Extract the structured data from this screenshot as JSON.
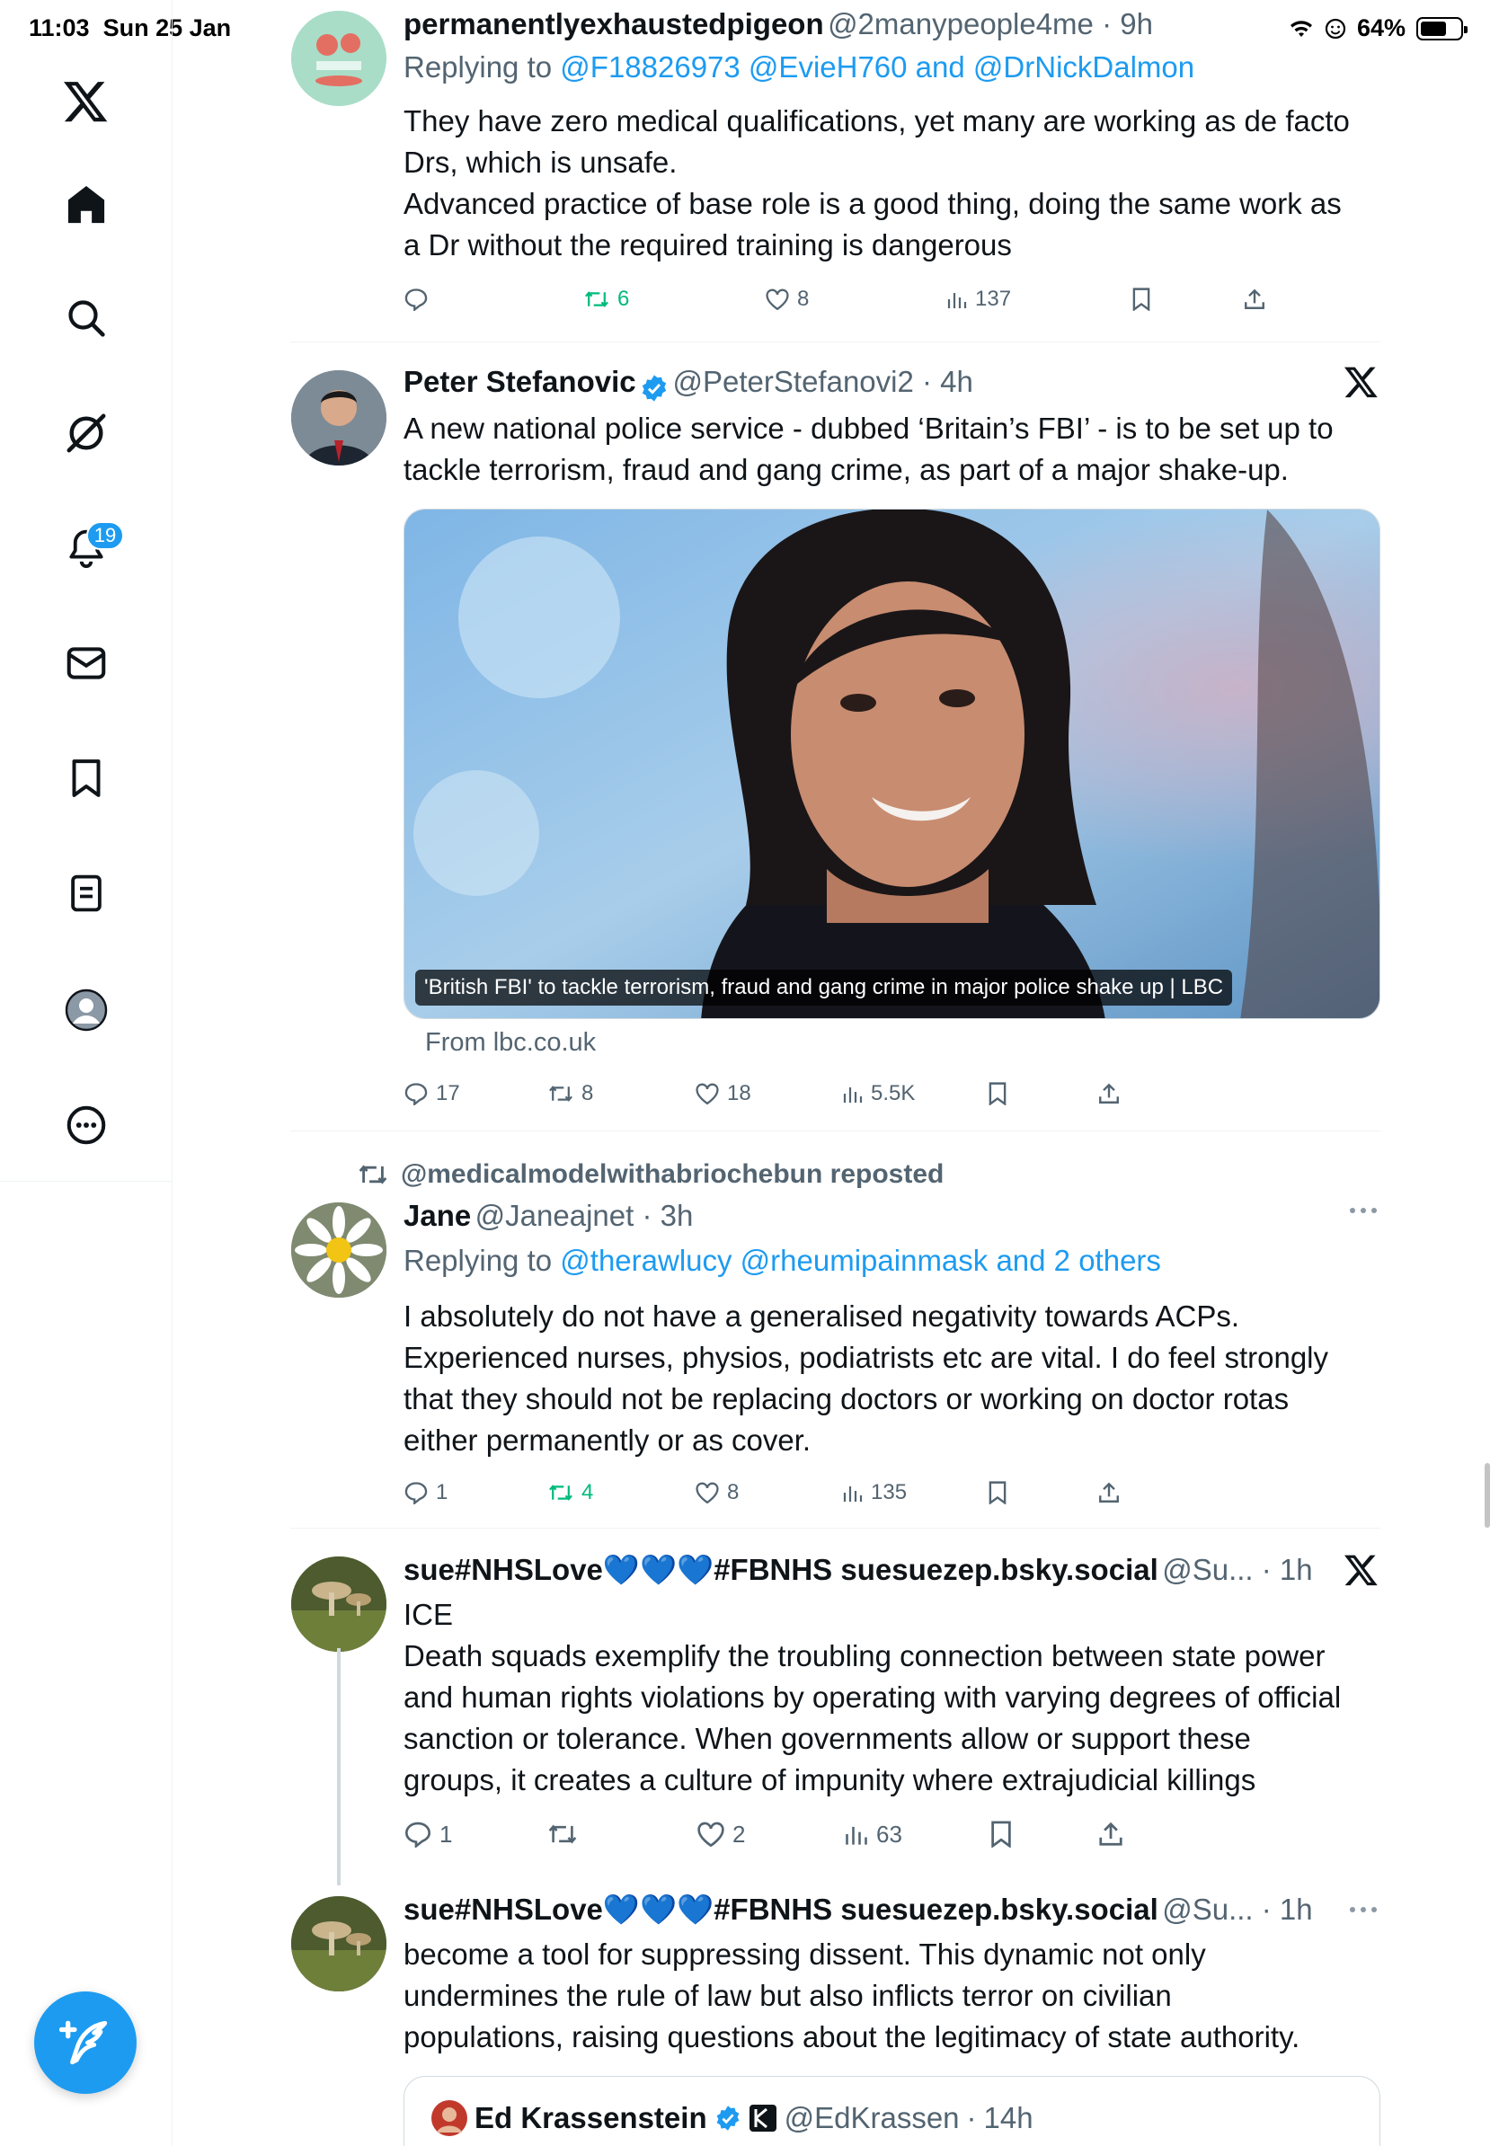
{
  "status_bar": {
    "time": "11:03",
    "date": "Sun 25 Jan",
    "battery": "64%",
    "battery_level": 0.64
  },
  "sidebar": {
    "items": [
      {
        "name": "x-logo-icon"
      },
      {
        "name": "home-icon"
      },
      {
        "name": "search-icon"
      },
      {
        "name": "grok-icon"
      },
      {
        "name": "notifications-icon"
      },
      {
        "name": "messages-icon"
      },
      {
        "name": "bookmarks-icon"
      },
      {
        "name": "lists-icon"
      },
      {
        "name": "profile-icon"
      },
      {
        "name": "more-icon"
      }
    ],
    "notification_badge": "19",
    "compose_icon": "compose-icon"
  },
  "tweets": [
    {
      "name": "permanentlyexhaustedpigeon",
      "handle": "@2manypeople4me",
      "time": "9h",
      "replying_prefix": "Replying to",
      "replying_to": "@F18826973 @EvieH760 and @DrNickDalmon",
      "text": [
        "They have zero medical qualifications, yet many are working as de facto",
        "Drs, which is unsafe.",
        "Advanced practice of base role is a good thing, doing the same work as",
        "a Dr without the required training is dangerous"
      ],
      "replies": "",
      "retweets": "6",
      "likes": "8",
      "views": "137"
    },
    {
      "name": "Peter Stefanovic",
      "handle": "@PeterStefanovi2",
      "time": "4h",
      "text": [
        "A new national police service - dubbed ‘Britain’s FBI’ - is to be set up to",
        "tackle terrorism, fraud and gang crime, as part of a major shake-up."
      ],
      "card_caption": "'British FBI' to tackle terrorism, fraud and gang crime in major police shake up | LBC",
      "card_source": "From lbc.co.uk",
      "replies": "17",
      "retweets": "8",
      "likes": "18",
      "views": "5.5K"
    },
    {
      "reposted_by": "@medicalmodelwithabriochebun reposted",
      "name": "Jane",
      "handle": "@Janeajnet",
      "time": "3h",
      "replying_prefix": "Replying to",
      "replying_to": "@therawlucy @rheumipainmask and 2 others",
      "text": [
        "I absolutely do not have a generalised negativity towards ACPs.",
        "Experienced nurses, physios, podiatrists etc are vital. I do feel strongly",
        "that they should not be replacing doctors or working on doctor rotas",
        "either permanently or as cover."
      ],
      "replies": "1",
      "retweets": "4",
      "likes": "8",
      "views": "135"
    },
    {
      "name": "sue#NHSLove💙💙💙#FBNHS suesuezep.bsky.social",
      "handle": "@Su...",
      "time": "1h",
      "text": [
        "ICE",
        "Death squads exemplify the troubling connection between state power",
        "and human rights violations by operating with varying degrees of official",
        "sanction or tolerance. When governments allow or support these",
        "groups, it creates a culture of impunity where extrajudicial killings"
      ],
      "replies": "1",
      "retweets": "",
      "likes": "2",
      "views": "63"
    },
    {
      "name": "sue#NHSLove💙💙💙#FBNHS suesuezep.bsky.social",
      "handle": "@Su...",
      "time": "1h",
      "text": [
        "become a tool for suppressing dissent. This dynamic not only",
        "undermines the rule of law but also inflicts terror on civilian",
        "populations, raising questions about the legitimacy of state authority."
      ],
      "quote_name": "Ed Krassenstein",
      "quote_handle": "@EdKrassen",
      "quote_time": "14h"
    }
  ],
  "colors": {
    "accent": "#1d9bf0",
    "retweet_green": "#00ba7c",
    "secondary_text": "#536471"
  }
}
